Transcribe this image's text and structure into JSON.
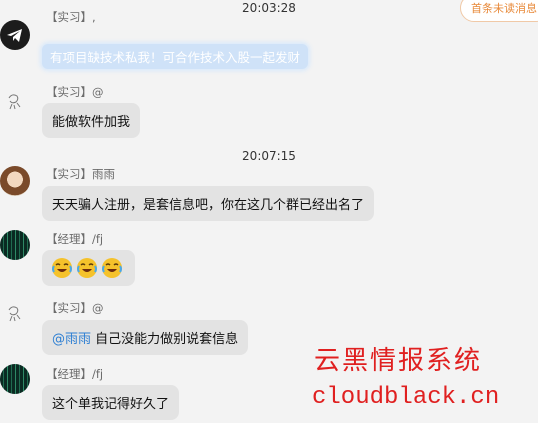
{
  "unread_badge": "首条未读消息",
  "timestamps": [
    "20:03:28",
    "20:07:15"
  ],
  "messages": [
    {
      "sender": "【实习】,",
      "text": "有项目缺技术私我！可合作技术入股一起发财",
      "avatar": "telegram-icon"
    },
    {
      "sender": "【实习】@",
      "text": "能做软件加我",
      "avatar": "sketch-avatar"
    },
    {
      "sender": "【实习】雨雨",
      "text": "天天骗人注册，是套信息吧，你在这几个群已经出名了",
      "avatar": "girl-avatar"
    },
    {
      "sender": "【经理】/fj",
      "emojis": [
        "crying-laughing-emoji",
        "crying-laughing-emoji",
        "crying-laughing-emoji"
      ],
      "avatar": "matrix-avatar"
    },
    {
      "sender": "【实习】@",
      "mention": "@雨雨",
      "text": " 自己没能力做别说套信息",
      "avatar": "sketch-avatar"
    },
    {
      "sender": "【经理】/fj",
      "text": "这个单我记得好久了",
      "avatar": "matrix-avatar"
    }
  ],
  "watermark": {
    "cn": "云黑情报系统",
    "en": "cloudblack.cn"
  },
  "colors": {
    "bubble": "#e3e3e3",
    "highlight": "#cfe2f8",
    "mention": "#2d7fd3",
    "watermark": "#e02020",
    "badge": "#e88a3a"
  }
}
